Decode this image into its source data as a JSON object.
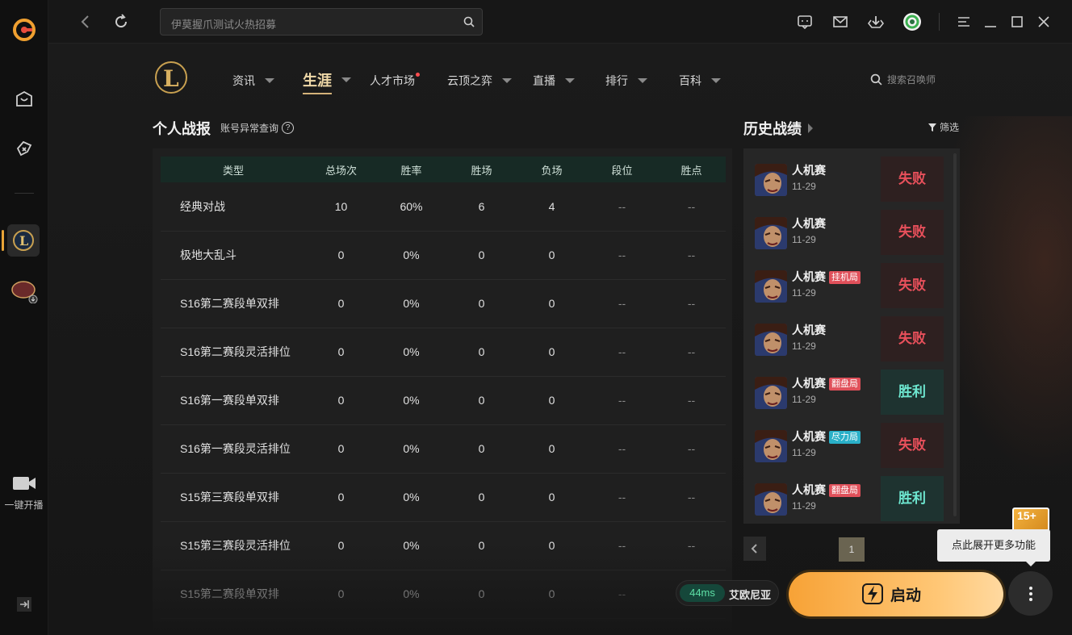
{
  "topbar": {
    "search_placeholder": "伊莫握爪测试火热招募"
  },
  "rail": {
    "stream_label": "一键开播"
  },
  "nav": {
    "items": [
      {
        "label": "资讯"
      },
      {
        "label": "生涯"
      },
      {
        "label": "人才市场"
      },
      {
        "label": "云顶之弈"
      },
      {
        "label": "直播"
      },
      {
        "label": "排行"
      },
      {
        "label": "百科"
      }
    ],
    "summoner_search": "搜索召唤师"
  },
  "stats": {
    "title": "个人战报",
    "subtitle": "账号异常查询",
    "headers": [
      "类型",
      "总场次",
      "胜率",
      "胜场",
      "负场",
      "段位",
      "胜点"
    ],
    "rows": [
      [
        "经典对战",
        "10",
        "60%",
        "6",
        "4",
        "--",
        "--"
      ],
      [
        "极地大乱斗",
        "0",
        "0%",
        "0",
        "0",
        "--",
        "--"
      ],
      [
        "S16第二赛段单双排",
        "0",
        "0%",
        "0",
        "0",
        "--",
        "--"
      ],
      [
        "S16第二赛段灵活排位",
        "0",
        "0%",
        "0",
        "0",
        "--",
        "--"
      ],
      [
        "S16第一赛段单双排",
        "0",
        "0%",
        "0",
        "0",
        "--",
        "--"
      ],
      [
        "S16第一赛段灵活排位",
        "0",
        "0%",
        "0",
        "0",
        "--",
        "--"
      ],
      [
        "S15第三赛段单双排",
        "0",
        "0%",
        "0",
        "0",
        "--",
        "--"
      ],
      [
        "S15第三赛段灵活排位",
        "0",
        "0%",
        "0",
        "0",
        "--",
        "--"
      ],
      [
        "S15第二赛段单双排",
        "0",
        "0%",
        "0",
        "0",
        "--",
        "--"
      ]
    ]
  },
  "history": {
    "title": "历史战绩",
    "filter": "筛选",
    "matches": [
      {
        "mode": "人机赛",
        "tag": "",
        "tag_color": "",
        "date": "11-29",
        "result": "失败",
        "won": false
      },
      {
        "mode": "人机赛",
        "tag": "",
        "tag_color": "",
        "date": "11-29",
        "result": "失败",
        "won": false
      },
      {
        "mode": "人机赛",
        "tag": "挂机局",
        "tag_color": "#e0505a",
        "date": "11-29",
        "result": "失败",
        "won": false
      },
      {
        "mode": "人机赛",
        "tag": "",
        "tag_color": "",
        "date": "11-29",
        "result": "失败",
        "won": false
      },
      {
        "mode": "人机赛",
        "tag": "翻盘局",
        "tag_color": "#e0505a",
        "date": "11-29",
        "result": "胜利",
        "won": true
      },
      {
        "mode": "人机赛",
        "tag": "尽力局",
        "tag_color": "#2ab0c8",
        "date": "11-29",
        "result": "失败",
        "won": false
      },
      {
        "mode": "人机赛",
        "tag": "翻盘局",
        "tag_color": "#e0505a",
        "date": "11-29",
        "result": "胜利",
        "won": true
      }
    ],
    "page": "1"
  },
  "footer": {
    "ping": "44ms",
    "server": "艾欧尼亚",
    "launch": "启动",
    "tooltip": "点此展开更多功能",
    "badge": "15+"
  },
  "colors": {
    "accent": "#f7a236",
    "win": "#6ee7d0",
    "loss": "#e8505b"
  }
}
